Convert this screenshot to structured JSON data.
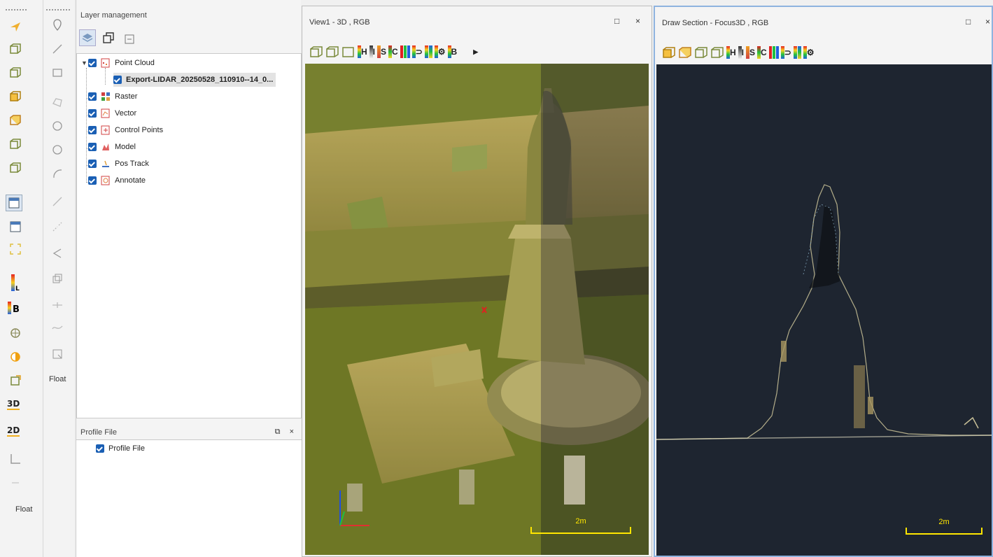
{
  "left_toolbar": {
    "float_label": "Float"
  },
  "draw_toolbar": {
    "float_label": "Float"
  },
  "layer_panel": {
    "title": "Layer management",
    "items": [
      {
        "label": "Point Cloud",
        "icon": "point-cloud-layer-icon"
      },
      {
        "label": "Export-LIDAR_20250528_110910--14_0...",
        "icon": "none"
      },
      {
        "label": "Raster",
        "icon": "raster-layer-icon"
      },
      {
        "label": "Vector",
        "icon": "vector-layer-icon"
      },
      {
        "label": "Control Points",
        "icon": "control-points-icon"
      },
      {
        "label": "Model",
        "icon": "model-layer-icon"
      },
      {
        "label": "Pos Track",
        "icon": "pos-track-icon"
      },
      {
        "label": "Annotate",
        "icon": "annotate-layer-icon"
      }
    ]
  },
  "profile_panel": {
    "title": "Profile File",
    "item": "Profile File",
    "controls": "7 ×"
  },
  "view1": {
    "title": "View1 - 3D , RGB",
    "scale_label": "2m"
  },
  "view2": {
    "title": "Draw Section - Focus3D , RGB",
    "scale_label": "2m"
  },
  "colors": {
    "accent": "#1a5fb4",
    "section_bg": "#1e2530",
    "scale_bar": "#ffe600",
    "overlay": "#b9b52a"
  }
}
